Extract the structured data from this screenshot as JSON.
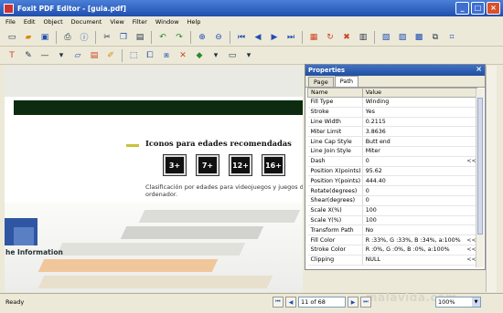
{
  "window": {
    "title": "Foxit PDF Editor - [guia.pdf]"
  },
  "menu": [
    "File",
    "Edit",
    "Object",
    "Document",
    "View",
    "Filter",
    "Window",
    "Help"
  ],
  "document": {
    "heading": "Iconos para edades recomendadas",
    "ratings": [
      "3+",
      "7+",
      "12+",
      "16+"
    ],
    "subtext": "Clasificación por edades para videojuegos y juegos de ordenador.",
    "logo_text": "he Information"
  },
  "properties": {
    "title": "Properties",
    "tabs": [
      "Page",
      "Path"
    ],
    "active_tab": "Path",
    "col_name": "Name",
    "col_value": "Value",
    "rows": [
      {
        "name": "Fill Type",
        "value": "Winding",
        "action": ""
      },
      {
        "name": "Stroke",
        "value": "Yes",
        "action": ""
      },
      {
        "name": "Line Width",
        "value": "0.2115",
        "action": ""
      },
      {
        "name": "Miter Limit",
        "value": "3.8636",
        "action": ""
      },
      {
        "name": "Line Cap Style",
        "value": "Butt end",
        "action": ""
      },
      {
        "name": "Line Join Style",
        "value": "Miter",
        "action": ""
      },
      {
        "name": "Dash",
        "value": "0",
        "action": "<<"
      },
      {
        "name": "Position X(points)",
        "value": "95.62",
        "action": ""
      },
      {
        "name": "Position Y(points)",
        "value": "444.40",
        "action": ""
      },
      {
        "name": "Rotate(degrees)",
        "value": "0",
        "action": ""
      },
      {
        "name": "Shear(degrees)",
        "value": "0",
        "action": ""
      },
      {
        "name": "Scale X(%)",
        "value": "100",
        "action": ""
      },
      {
        "name": "Scale Y(%)",
        "value": "100",
        "action": ""
      },
      {
        "name": "Transform Path",
        "value": "No",
        "action": ""
      },
      {
        "name": "Fill Color",
        "value": "R :33%, G :33%, B :34%, a:100%",
        "action": "<<"
      },
      {
        "name": "Stroke Color",
        "value": "R :0%, G :0%, B :0%, a:100%",
        "action": "<<"
      },
      {
        "name": "Clipping",
        "value": "NULL",
        "action": "<<"
      }
    ]
  },
  "status": {
    "ready": "Ready",
    "page": "11 of 68",
    "zoom": "100%",
    "watermark": "malavida.com"
  },
  "colors": {
    "titlebar": "#2c5cc0",
    "dark_bar": "#0c2b10",
    "accent_bullet": "#c8c23a"
  }
}
